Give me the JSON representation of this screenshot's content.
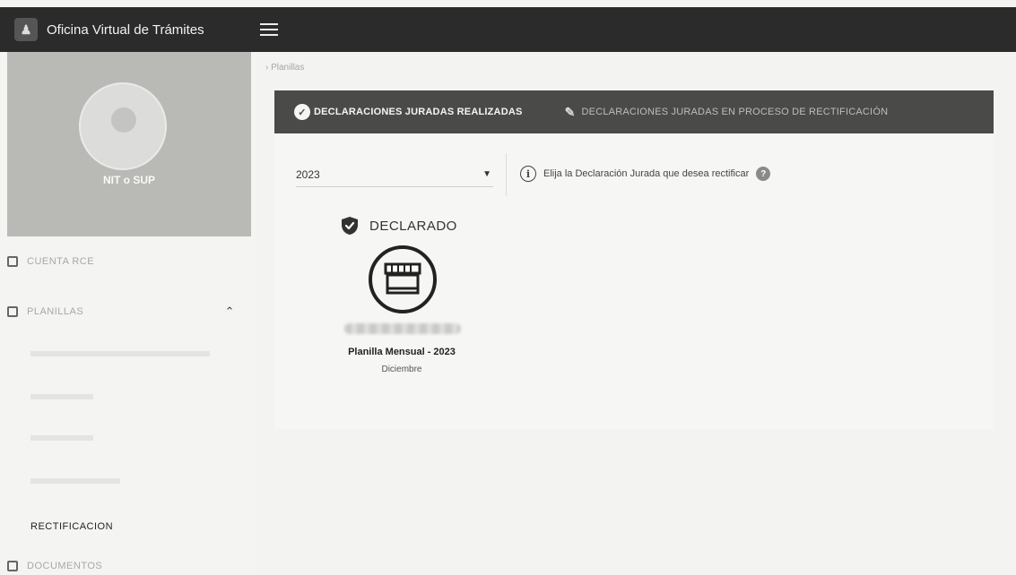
{
  "app": {
    "title": "Oficina Virtual de Trámites",
    "logo_icon": "app-logo-icon",
    "menu_icon": "hamburger-menu-icon"
  },
  "sidebar": {
    "profile_name": "NIT o SUP",
    "items": [
      {
        "label": "CUENTA RCE",
        "icon": "id-card-icon"
      },
      {
        "label": "PLANILLAS",
        "icon": "document-stack-icon",
        "expanded": true
      },
      {
        "label": "RECTIFICACION",
        "active": true
      },
      {
        "label": "DOCUMENTOS",
        "icon": "folder-icon"
      }
    ]
  },
  "breadcrumb": "› Planillas",
  "tabs": [
    {
      "label": "DECLARACIONES JURADAS REALIZADAS",
      "icon": "shield-check-icon",
      "active": true
    },
    {
      "label": "DECLARACIONES JURADAS EN PROCESO DE RECTIFICACIÓN",
      "icon": "pencil-icon",
      "active": false
    }
  ],
  "filter": {
    "year": "2023"
  },
  "hint": {
    "text": "Elija la Declaración Jurada que desea rectificar",
    "info_icon": "info-icon",
    "help_icon": "help-icon"
  },
  "declaration": {
    "status": "DECLARADO",
    "status_icon": "shield-check-icon",
    "icon": "storefront-icon",
    "title": "Planilla Mensual - 2023",
    "month": "Diciembre"
  },
  "colors": {
    "topbar": "#2b2b2b",
    "tabbar": "#4a4a48",
    "background": "#f3f3f1"
  }
}
